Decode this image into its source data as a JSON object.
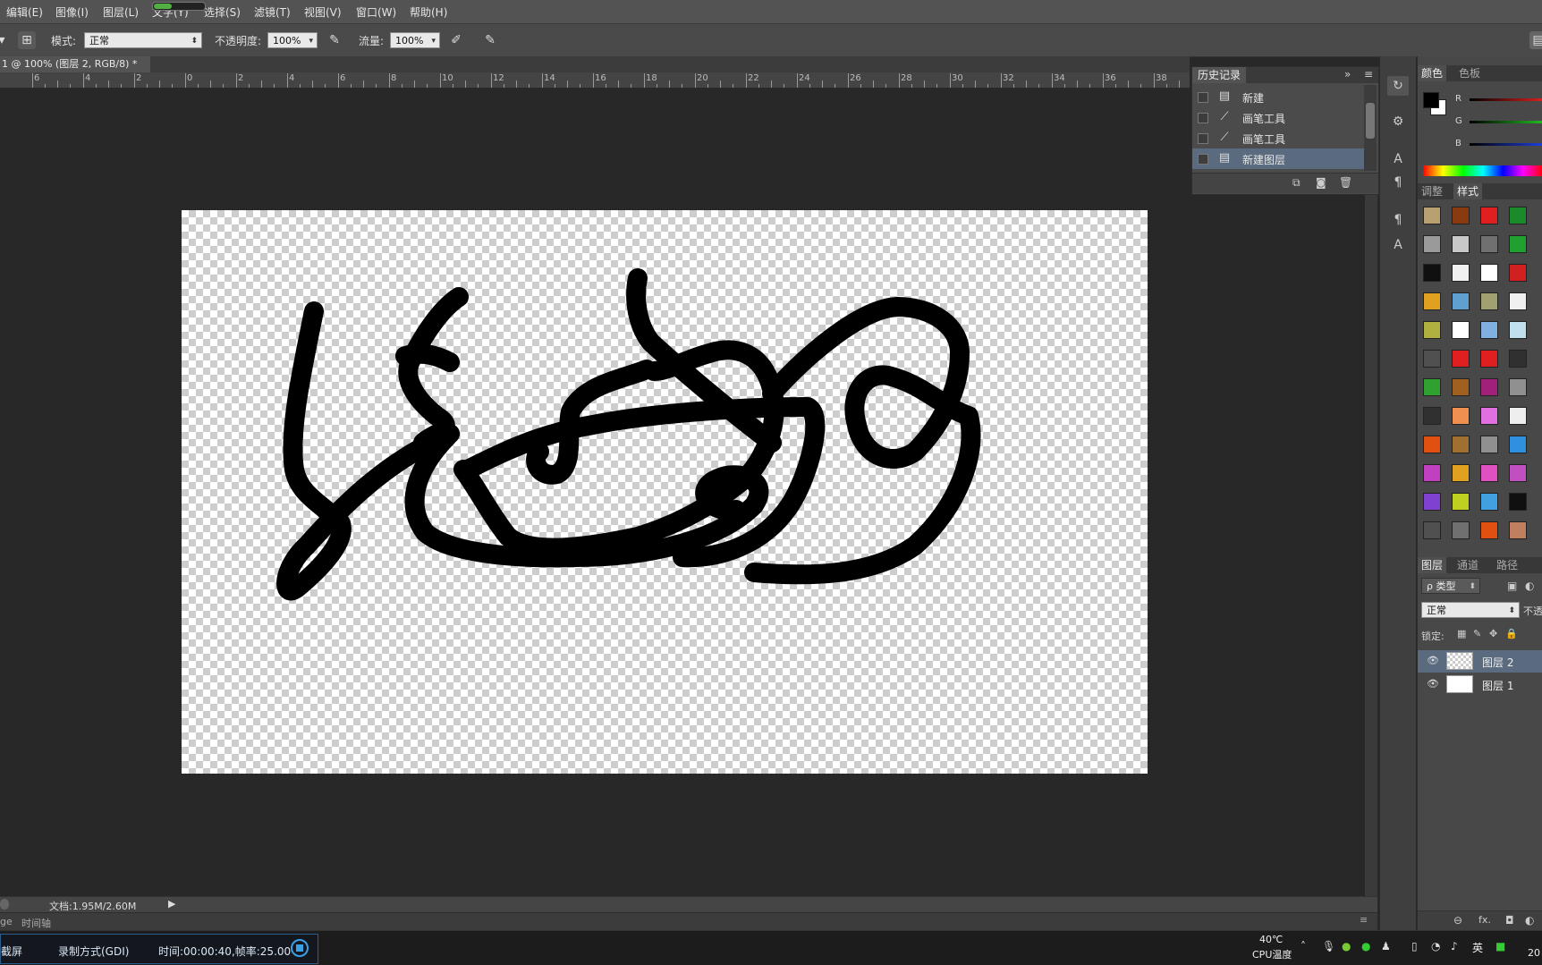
{
  "menu": [
    "编辑(E)",
    "图像(I)",
    "图层(L)",
    "文字(Y)",
    "选择(S)",
    "滤镜(T)",
    "视图(V)",
    "窗口(W)",
    "帮助(H)"
  ],
  "top_progress": 0.35,
  "options": {
    "mode_label": "模式:",
    "mode_value": "正常",
    "opacity_label": "不透明度:",
    "opacity_value": "100%",
    "flow_label": "流量:",
    "flow_value": "100%"
  },
  "doc_tab": {
    "title": "1 @ 100% (图层 2, RGB/8) *",
    "close": "×"
  },
  "ruler_labels": [
    "6",
    "4",
    "2",
    "0",
    "2",
    "4",
    "6",
    "8",
    "10",
    "12",
    "14",
    "16",
    "18",
    "20",
    "22",
    "24",
    "26",
    "28",
    "30",
    "32",
    "34",
    "36",
    "38"
  ],
  "history": {
    "tab": "历史记录",
    "menu_icon": "≡",
    "collapse_icon": "»",
    "items": [
      {
        "label": "新建",
        "icon": "document-icon"
      },
      {
        "label": "画笔工具",
        "icon": "brush-icon"
      },
      {
        "label": "画笔工具",
        "icon": "brush-icon"
      },
      {
        "label": "新建图层",
        "icon": "document-icon"
      }
    ],
    "selected_index": 3
  },
  "color_panel": {
    "tabs": [
      "颜色",
      "色板"
    ],
    "channels": [
      "R",
      "G",
      "B"
    ],
    "slider_colors": [
      "#e02020",
      "#20c020",
      "#2040e0"
    ]
  },
  "styles_panel": {
    "tabs": [
      "调整",
      "样式"
    ]
  },
  "layers_panel": {
    "tabs": [
      "图层",
      "通道",
      "路径"
    ],
    "filter_label": "ρ 类型",
    "blend_mode": "正常",
    "opacity_label": "不透",
    "lock_label": "锁定:",
    "layers": [
      {
        "name": "图层 2",
        "selected": true
      },
      {
        "name": "图层 1",
        "selected": false
      }
    ],
    "footer_icons": [
      "⊖",
      "fx.",
      "◘",
      "◐"
    ]
  },
  "status": {
    "doc_size": "文档:1.95M/2.60M",
    "left_text": "ge",
    "timeline_tab": "时间轴"
  },
  "recorder": {
    "capture": "截屏",
    "method": "录制方式(GDI)",
    "time": "时间:00:00:40,帧率:25.00"
  },
  "tray": {
    "temp": "40℃",
    "cpu": "CPU温度",
    "ime": "英",
    "year": "20"
  },
  "colors": {
    "accent": "#2c5c8c",
    "selected_row": "#5a6b80",
    "foreground": "#000000",
    "background": "#ffffff"
  }
}
